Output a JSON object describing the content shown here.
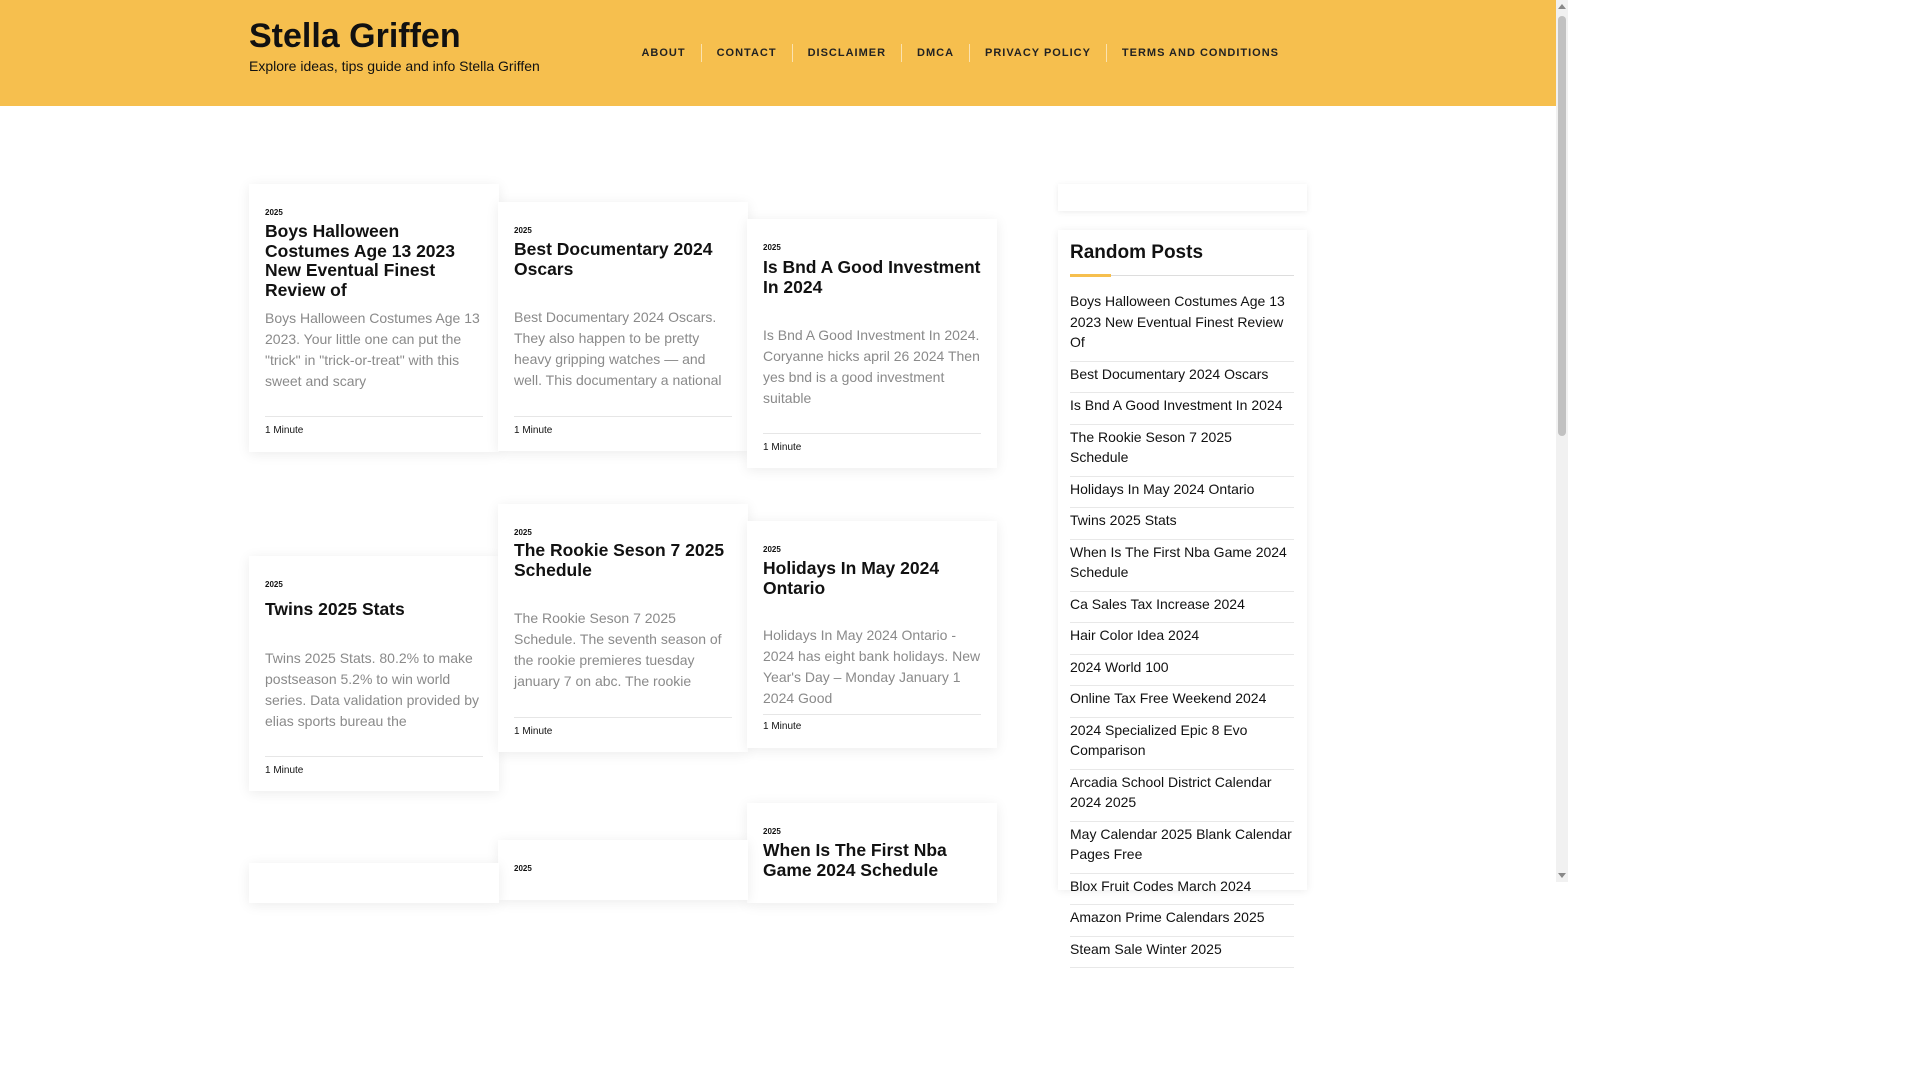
{
  "site": {
    "title": "Stella Griffen",
    "tagline": "Explore ideas, tips guide and info Stella Griffen"
  },
  "nav": [
    "ABOUT",
    "CONTACT",
    "DISCLAIMER",
    "DMCA",
    "PRIVACY POLICY",
    "TERMS AND CONDITIONS"
  ],
  "posts": [
    {
      "year": "2025",
      "title": "Boys Halloween Costumes Age 13 2023 New Eventual Finest Review of",
      "excerpt": "Boys Halloween Costumes Age 13 2023. Your little one can put the \"trick\" in \"trick-or-treat\" with this sweet and scary",
      "read_time": "1 Minute"
    },
    {
      "year": "2025",
      "title": "Best Documentary 2024 Oscars",
      "excerpt": "Best Documentary 2024 Oscars. They also happen to be pretty heavy gripping watches — and well. This documentary a national",
      "read_time": "1 Minute"
    },
    {
      "year": "2025",
      "title": "Is Bnd A Good Investment In 2024",
      "excerpt": "Is Bnd A Good Investment In 2024. Coryanne hicks april 26 2024 Then yes bnd is a good investment suitable",
      "read_time": "1 Minute"
    },
    {
      "year": "2025",
      "title": "Twins 2025 Stats",
      "excerpt": "Twins 2025 Stats. 80.2% to make postseason 5.2% to win world series. Data validation provided by elias sports bureau the",
      "read_time": "1 Minute"
    },
    {
      "year": "2025",
      "title": "The Rookie Seson 7 2025 Schedule",
      "excerpt": "The Rookie Seson 7 2025 Schedule. The seventh season of the rookie premieres tuesday january 7 on abc. The rookie",
      "read_time": "1 Minute"
    },
    {
      "year": "2025",
      "title": "Holidays In May 2024 Ontario",
      "excerpt": "Holidays In May 2024 Ontario - 2024 has eight bank holidays. New Year's Day – Monday January 1 2024 Good",
      "read_time": "1 Minute"
    },
    {
      "year": "2025",
      "title": "When Is The First Nba Game 2024 Schedule"
    },
    {
      "year": "2025"
    },
    {}
  ],
  "sidebar": {
    "widget_title": "Random Posts",
    "items": [
      "Boys Halloween Costumes Age 13 2023 New Eventual Finest Review Of",
      "Best Documentary 2024 Oscars",
      "Is Bnd A Good Investment In 2024",
      "The Rookie Seson 7 2025 Schedule",
      "Holidays In May 2024 Ontario",
      "Twins 2025 Stats",
      "When Is The First Nba Game 2024 Schedule",
      "Ca Sales Tax Increase 2024",
      "Hair Color Idea 2024",
      "2024 World 100",
      "Online Tax Free Weekend 2024",
      "2024 Specialized Epic 8 Evo Comparison",
      "Arcadia School District Calendar 2024 2025",
      "May Calendar 2025 Blank Calendar Pages Free",
      "Blox Fruit Codes March 2024",
      "Amazon Prime Calendars 2025",
      "Steam Sale Winter 2025"
    ]
  },
  "colors": {
    "accent": "#f6bf4e",
    "excerpt_text": "#8a8a8a"
  }
}
